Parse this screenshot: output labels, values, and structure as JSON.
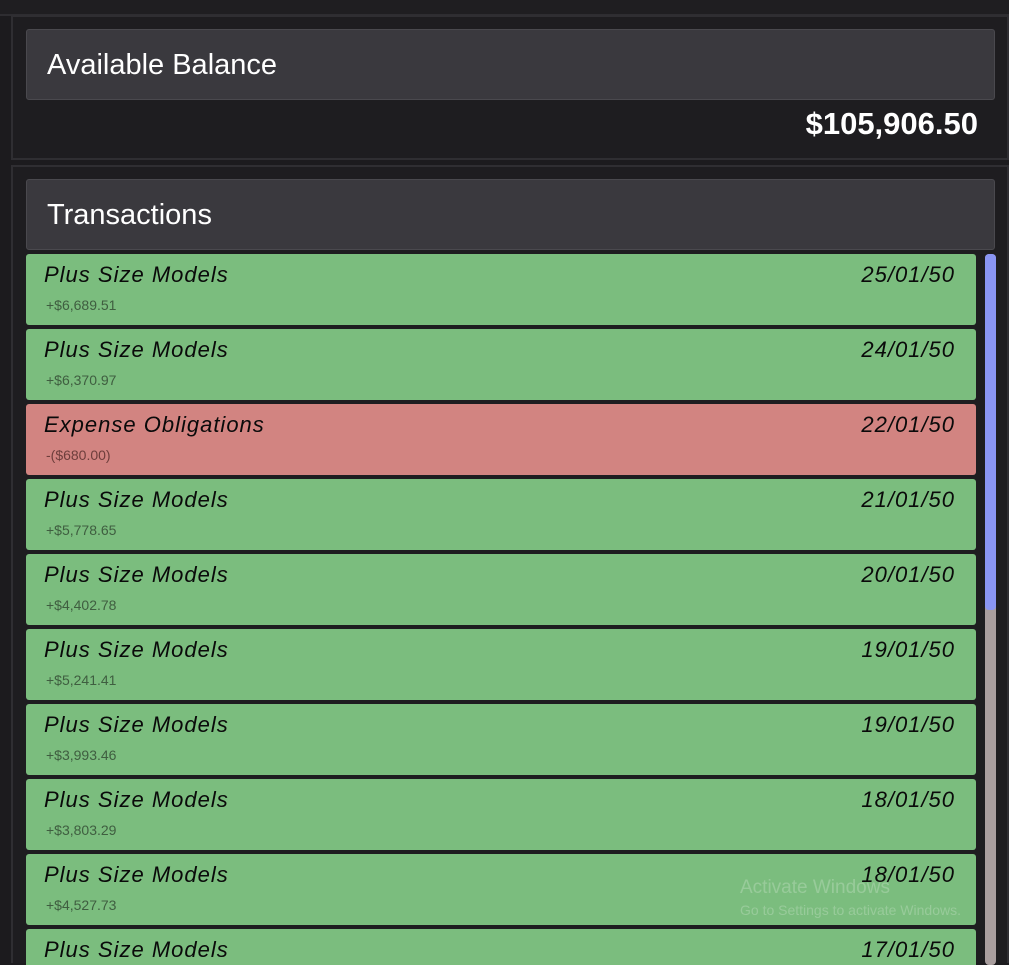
{
  "balance": {
    "title": "Available Balance",
    "amount": "$105,906.50"
  },
  "transactions": {
    "title": "Transactions",
    "items": [
      {
        "name": "Plus Size Models",
        "date": "25/01/50",
        "amount": "+$6,689.51",
        "type": "income"
      },
      {
        "name": "Plus Size Models",
        "date": "24/01/50",
        "amount": "+$6,370.97",
        "type": "income"
      },
      {
        "name": "Expense Obligations",
        "date": "22/01/50",
        "amount": "-($680.00)",
        "type": "expense"
      },
      {
        "name": "Plus Size Models",
        "date": "21/01/50",
        "amount": "+$5,778.65",
        "type": "income"
      },
      {
        "name": "Plus Size Models",
        "date": "20/01/50",
        "amount": "+$4,402.78",
        "type": "income"
      },
      {
        "name": "Plus Size Models",
        "date": "19/01/50",
        "amount": "+$5,241.41",
        "type": "income"
      },
      {
        "name": "Plus Size Models",
        "date": "19/01/50",
        "amount": "+$3,993.46",
        "type": "income"
      },
      {
        "name": "Plus Size Models",
        "date": "18/01/50",
        "amount": "+$3,803.29",
        "type": "income"
      },
      {
        "name": "Plus Size Models",
        "date": "18/01/50",
        "amount": "+$4,527.73",
        "type": "income"
      },
      {
        "name": "Plus Size Models",
        "date": "17/01/50",
        "amount": "",
        "type": "income"
      }
    ]
  },
  "scrollbar": {
    "visible_fraction": 0.5
  },
  "watermark": {
    "title": "Activate Windows",
    "subtitle": "Go to Settings to activate Windows."
  },
  "colors": {
    "income": "#7bbd7e",
    "expense": "#d28481",
    "scroll_thumb": "#8a95f3",
    "scroll_track": "#a99e9e"
  }
}
